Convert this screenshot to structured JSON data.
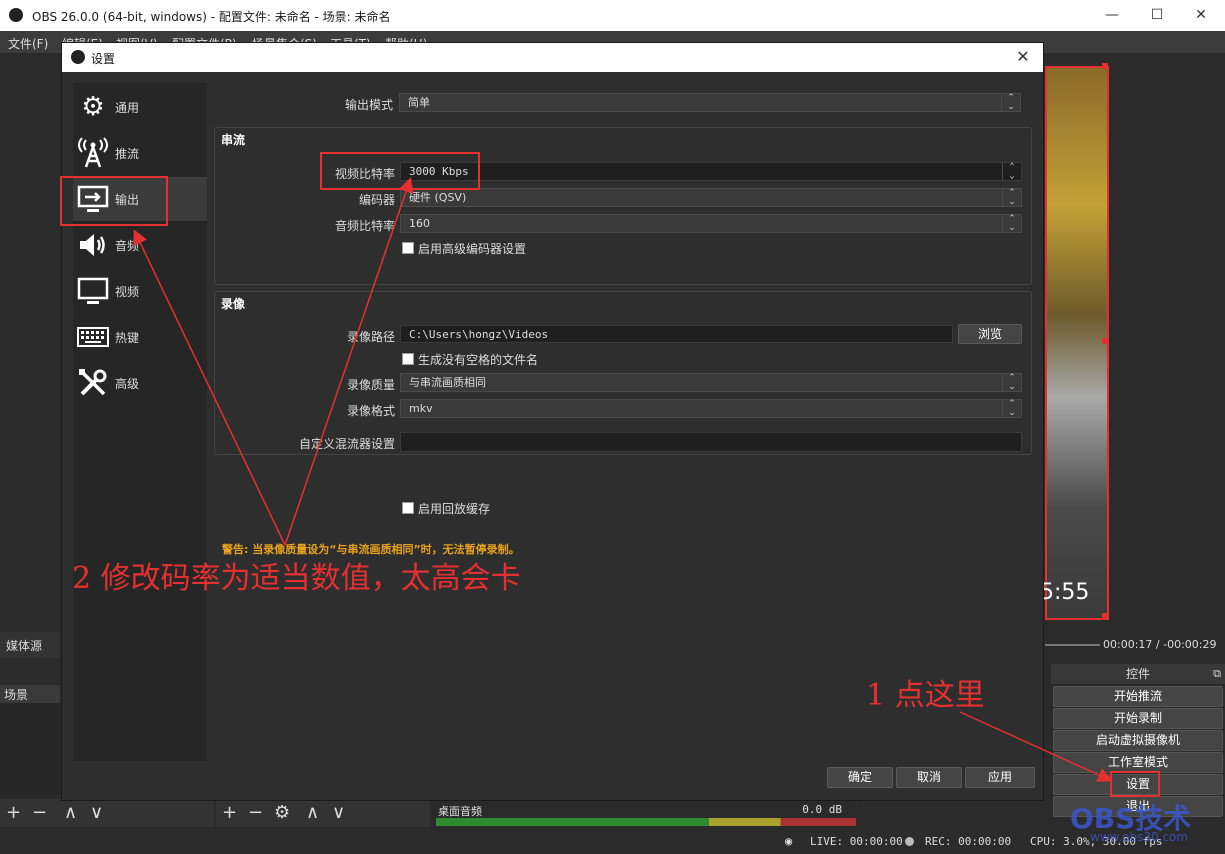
{
  "main_window": {
    "title": "OBS 26.0.0 (64-bit, windows) - 配置文件: 未命名 - 场景: 未命名",
    "menu": [
      "文件(F)",
      "编辑(E)",
      "视图(V)",
      "配置文件(P)",
      "场景集合(S)",
      "工具(T)",
      "帮助(H)"
    ],
    "preview_time": "5:55",
    "media_time": "00:00:17 / -00:00:29",
    "sources_tab": "媒体源",
    "scenes_header": "场景",
    "controls_header": "控件",
    "controls": [
      "开始推流",
      "开始录制",
      "启动虚拟摄像机",
      "工作室模式",
      "设置",
      "退出"
    ],
    "mixer_track": "桌面音频",
    "mixer_db": "0.0 dB",
    "status": {
      "live": "LIVE: 00:00:00",
      "rec": "REC: 00:00:00",
      "cpu": "CPU: 3.0%, 30.00 fps"
    },
    "watermark": "OBS技术",
    "watermark_sub": "www.obs30.com"
  },
  "dialog": {
    "title": "设置",
    "sidebar": [
      {
        "label": "通用",
        "icon": "gear-icon"
      },
      {
        "label": "推流",
        "icon": "antenna-icon"
      },
      {
        "label": "输出",
        "icon": "output-monitor-icon"
      },
      {
        "label": "音频",
        "icon": "speaker-icon"
      },
      {
        "label": "视频",
        "icon": "monitor-icon"
      },
      {
        "label": "热键",
        "icon": "keyboard-icon"
      },
      {
        "label": "高级",
        "icon": "tools-icon"
      }
    ],
    "output_mode_label": "输出模式",
    "output_mode_value": "简单",
    "streaming": {
      "title": "串流",
      "video_bitrate_label": "视频比特率",
      "video_bitrate_value": "3000 Kbps",
      "encoder_label": "编码器",
      "encoder_value": "硬件 (QSV)",
      "audio_bitrate_label": "音频比特率",
      "audio_bitrate_value": "160",
      "advanced_encoder_label": "启用高级编码器设置"
    },
    "recording": {
      "title": "录像",
      "path_label": "录像路径",
      "path_value": "C:\\Users\\hongz\\Videos",
      "browse": "浏览",
      "no_space_label": "生成没有空格的文件名",
      "quality_label": "录像质量",
      "quality_value": "与串流画质相同",
      "format_label": "录像格式",
      "format_value": "mkv",
      "muxer_label": "自定义混流器设置",
      "muxer_value": "",
      "replay_label": "启用回放缓存"
    },
    "warning": "警告: 当录像质量设为“与串流画质相同”时，无法暂停录制。",
    "buttons": {
      "ok": "确定",
      "cancel": "取消",
      "apply": "应用"
    }
  },
  "annotations": {
    "step1": "1 点这里",
    "step2": "2 修改码率为适当数值，太高会卡"
  }
}
